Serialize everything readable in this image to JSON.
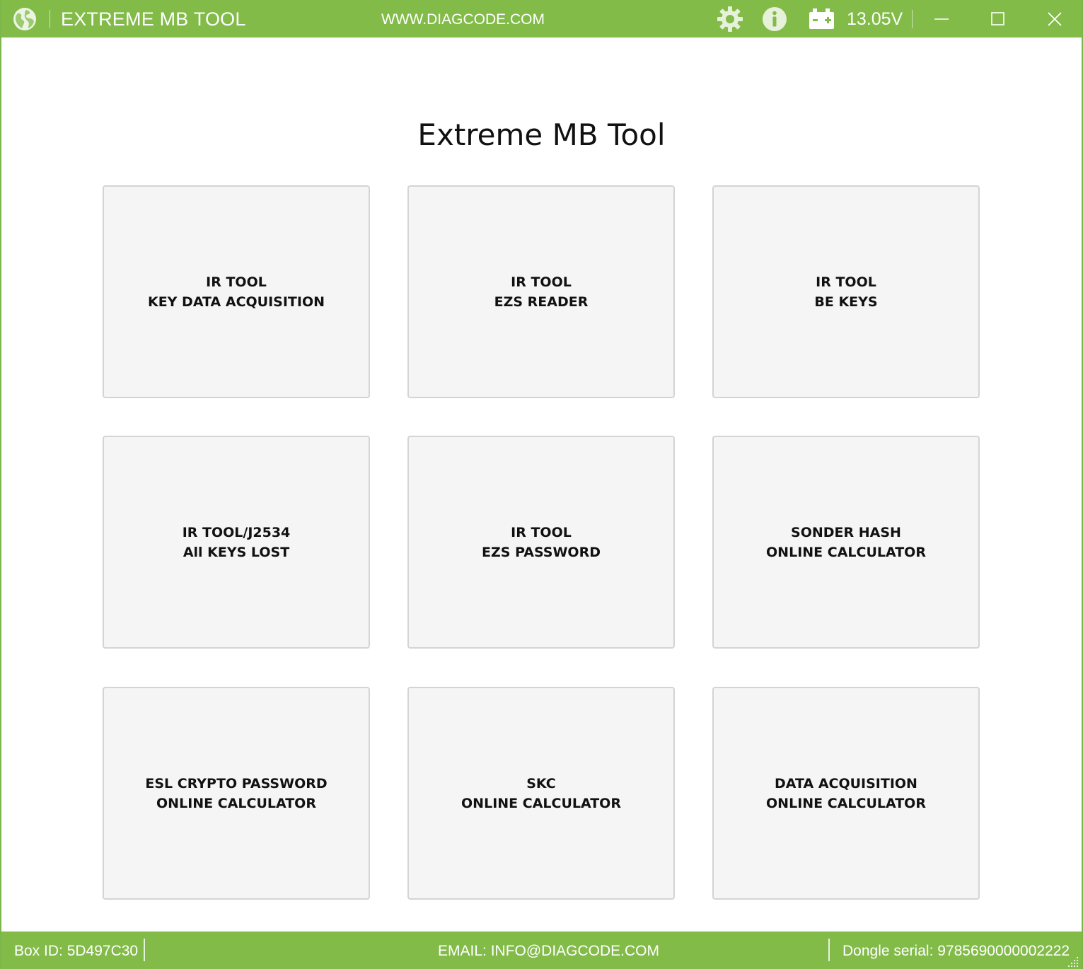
{
  "titlebar": {
    "app_title": "EXTREME MB TOOL",
    "site_url": "WWW.DIAGCODE.COM",
    "voltage": "13.05V",
    "icons": [
      "globe-icon",
      "gear-icon",
      "info-icon",
      "battery-icon",
      "minimize-icon",
      "maximize-icon",
      "close-icon"
    ]
  },
  "main": {
    "title": "Extreme MB Tool",
    "tiles": [
      {
        "line1": "IR TOOL",
        "line2": "KEY DATA ACQUISITION"
      },
      {
        "line1": "IR TOOL",
        "line2": "EZS READER"
      },
      {
        "line1": "IR TOOL",
        "line2": "BE KEYS"
      },
      {
        "line1": "IR TOOL/J2534",
        "line2": "All KEYS LOST"
      },
      {
        "line1": "IR TOOL",
        "line2": "EZS PASSWORD"
      },
      {
        "line1": "SONDER HASH",
        "line2": "ONLINE CALCULATOR"
      },
      {
        "line1": "ESL CRYPTO PASSWORD",
        "line2": "ONLINE CALCULATOR"
      },
      {
        "line1": "SKC",
        "line2": "ONLINE CALCULATOR"
      },
      {
        "line1": "DATA ACQUISITION",
        "line2": "ONLINE CALCULATOR"
      }
    ]
  },
  "statusbar": {
    "box_id": "Box ID: 5D497C30",
    "email": "EMAIL: INFO@DIAGCODE.COM",
    "dongle_serial": "Dongle serial: 9785690000002222"
  },
  "colors": {
    "accent": "#82bb48",
    "tile_bg": "#f5f5f5",
    "tile_border": "#d4d4d4"
  }
}
